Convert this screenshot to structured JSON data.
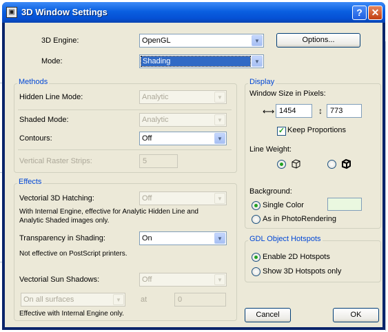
{
  "window": {
    "title": "3D Window Settings",
    "help_label": "?",
    "close_label": "✕"
  },
  "top": {
    "engine_label": "3D Engine:",
    "engine_value": "OpenGL",
    "mode_label": "Mode:",
    "mode_value": "Shading",
    "options_label": "Options..."
  },
  "methods": {
    "title": "Methods",
    "hidden_line_label": "Hidden Line Mode:",
    "hidden_line_value": "Analytic",
    "shaded_label": "Shaded Mode:",
    "shaded_value": "Analytic",
    "contours_label": "Contours:",
    "contours_value": "Off",
    "raster_label": "Vertical Raster Strips:",
    "raster_value": "5"
  },
  "effects": {
    "title": "Effects",
    "hatching_label": "Vectorial 3D Hatching:",
    "hatching_value": "Off",
    "hatching_note": "With Internal Engine, effective for Analytic Hidden Line and Analytic Shaded images only.",
    "transparency_label": "Transparency in Shading:",
    "transparency_value": "On",
    "transparency_note": "Not effective on PostScript printers.",
    "sun_label": "Vectorial Sun Shadows:",
    "sun_value": "Off",
    "surfaces_value": "On all surfaces",
    "at_label": "at",
    "at_value": "0",
    "sun_note": "Effective with Internal Engine only."
  },
  "display": {
    "title": "Display",
    "size_label": "Window Size in Pixels:",
    "width_value": "1454",
    "height_value": "773",
    "keep_label": "Keep Proportions",
    "line_weight_label": "Line Weight:",
    "background_label": "Background:",
    "single_color_label": "Single Color",
    "photo_label": "As in PhotoRendering",
    "swatch_color": "#eaf8e0"
  },
  "gdl": {
    "title": "GDL Object Hotspots",
    "enable_2d_label": "Enable 2D Hotspots",
    "show_3d_label": "Show 3D Hotspots only"
  },
  "buttons": {
    "cancel_label": "Cancel",
    "ok_label": "OK"
  },
  "colors": {
    "title_bar": "#0550d4",
    "selection": "#316ac5",
    "group_title": "#0046d5",
    "dialog_bg": "#ece9d8"
  }
}
